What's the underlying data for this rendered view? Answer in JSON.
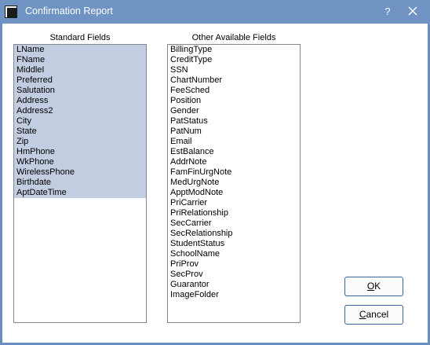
{
  "window": {
    "title": "Confirmation Report",
    "help_label": "?"
  },
  "standard_fields": {
    "label": "Standard Fields",
    "items": [
      "LName",
      "FName",
      "MiddleI",
      "Preferred",
      "Salutation",
      "Address",
      "Address2",
      "City",
      "State",
      "Zip",
      "HmPhone",
      "WkPhone",
      "WirelessPhone",
      "Birthdate",
      "AptDateTime"
    ]
  },
  "other_fields": {
    "label": "Other Available Fields",
    "items": [
      "BillingType",
      "CreditType",
      "SSN",
      "ChartNumber",
      "FeeSched",
      "Position",
      "Gender",
      "PatStatus",
      "PatNum",
      "Email",
      "EstBalance",
      "AddrNote",
      "FamFinUrgNote",
      "MedUrgNote",
      "ApptModNote",
      "PriCarrier",
      "PriRelationship",
      "SecCarrier",
      "SecRelationship",
      "StudentStatus",
      "SchoolName",
      "PriProv",
      "SecProv",
      "Guarantor",
      "ImageFolder"
    ]
  },
  "buttons": {
    "ok_accel": "O",
    "ok_rest": "K",
    "cancel_accel": "C",
    "cancel_rest": "ancel"
  },
  "colors": {
    "titlebar": "#6f94c4",
    "selection": "#c2cde2",
    "button_border": "#3c64a0"
  }
}
